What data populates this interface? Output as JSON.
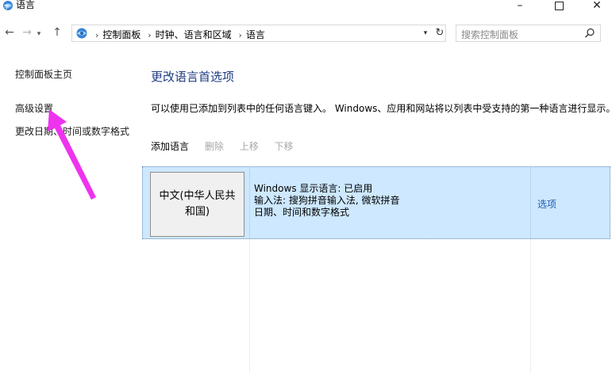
{
  "window": {
    "title": "语言",
    "controls": {
      "minimize": "–",
      "close": "✕"
    }
  },
  "navigation": {
    "back": "←",
    "forward": "→",
    "recent": "▾",
    "up": "↑",
    "breadcrumbs": [
      "控制面板",
      "时钟、语言和区域",
      "语言"
    ],
    "separator": "›",
    "dropdown": "▾",
    "refresh": "↻",
    "search_placeholder": "搜索控制面板"
  },
  "sidebar": {
    "items": [
      {
        "label": "控制面板主页"
      },
      {
        "label": "高级设置"
      },
      {
        "label": "更改日期、时间或数字格式"
      }
    ]
  },
  "main": {
    "title": "更改语言首选项",
    "description": "可以使用已添加到列表中的任何语言键入。 Windows、应用和网站将以列表中受支持的第一种语言进行显示。",
    "toolbar": {
      "add": "添加语言",
      "remove": "删除",
      "move_up": "上移",
      "move_down": "下移"
    },
    "languages": [
      {
        "name": "中文(中华人民共和国)",
        "details": [
          "Windows 显示语言: 已启用",
          "输入法: 搜狗拼音输入法, 微软拼音",
          "日期、时间和数字格式"
        ],
        "options": "选项"
      }
    ]
  },
  "colors": {
    "accent_title": "#1e3c82",
    "link": "#1e5bb0",
    "selection": "#cde8ff",
    "annotation_arrow": "#ee33ee"
  }
}
